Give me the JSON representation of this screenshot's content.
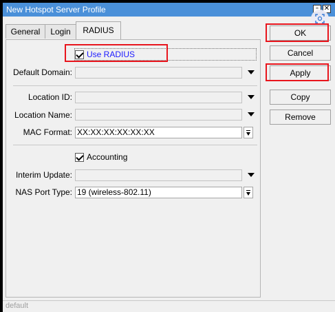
{
  "window": {
    "title": "New Hotspot Server Profile"
  },
  "tabs": [
    {
      "label": "General"
    },
    {
      "label": "Login"
    },
    {
      "label": "RADIUS"
    }
  ],
  "form": {
    "use_radius": {
      "label": "Use RADIUS",
      "checked": true
    },
    "default_domain": {
      "label": "Default Domain:",
      "value": ""
    },
    "location_id": {
      "label": "Location ID:",
      "value": ""
    },
    "location_name": {
      "label": "Location Name:",
      "value": ""
    },
    "mac_format": {
      "label": "MAC Format:",
      "value": "XX:XX:XX:XX:XX:XX"
    },
    "accounting": {
      "label": "Accounting",
      "checked": true
    },
    "interim_update": {
      "label": "Interim Update:",
      "value": ""
    },
    "nas_port_type": {
      "label": "NAS Port Type:",
      "value": "19 (wireless-802.11)"
    }
  },
  "buttons": {
    "ok": "OK",
    "cancel": "Cancel",
    "apply": "Apply",
    "copy": "Copy",
    "remove": "Remove"
  },
  "status": {
    "text": "default"
  },
  "colors": {
    "highlight": "#e8141c",
    "titlebar": "#4a90d9",
    "radius_label": "#1a1aff"
  },
  "icons": [
    "restore-icon",
    "close-icon",
    "scan-badge-icon",
    "dropdown-arrow-icon",
    "select-arrow-icon",
    "checkmark-icon"
  ]
}
